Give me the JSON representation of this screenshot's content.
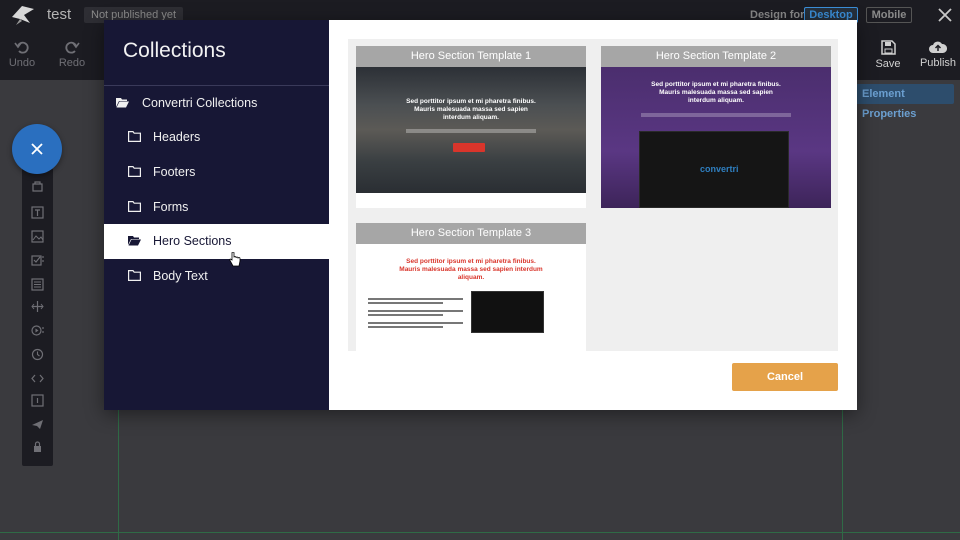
{
  "topbar": {
    "app_title": "test",
    "status": "Not published yet",
    "design_for_label": "Design for",
    "devices": [
      "Desktop",
      "Mobile"
    ],
    "active_device": "Desktop"
  },
  "toolbar": {
    "undo_label": "Undo",
    "redo_label": "Redo",
    "save_label": "Save",
    "publish_label": "Publish"
  },
  "canvas": {
    "element_properties_label": "Element Properties"
  },
  "modal": {
    "title": "Collections",
    "root_item": "Convertri Collections",
    "items": [
      "Headers",
      "Footers",
      "Forms",
      "Hero Sections",
      "Body Text"
    ],
    "active_item": "Hero Sections",
    "templates": [
      {
        "name": "Hero Section Template 1",
        "heading": "Sed porttitor ipsum et mi pharetra finibus. Mauris malesuada massa sed sapien interdum aliquam."
      },
      {
        "name": "Hero Section Template 2",
        "heading": "Sed porttitor ipsum et mi pharetra finibus. Mauris malesuada massa sed sapien interdum aliquam.",
        "video_logo": "convertri"
      },
      {
        "name": "Hero Section Template 3",
        "heading": "Sed porttitor ipsum et mi pharetra finibus. Mauris malesuada massa sed sapien interdum aliquam."
      }
    ],
    "cancel_label": "Cancel"
  },
  "colors": {
    "topbar_bg": "#1c1c22",
    "sidebar_bg": "#171735",
    "accent_blue": "#3b8fd9",
    "fab_blue": "#2a6fbf",
    "cancel_orange": "#e5a24a",
    "template_header_gray": "#a6a6a6"
  }
}
